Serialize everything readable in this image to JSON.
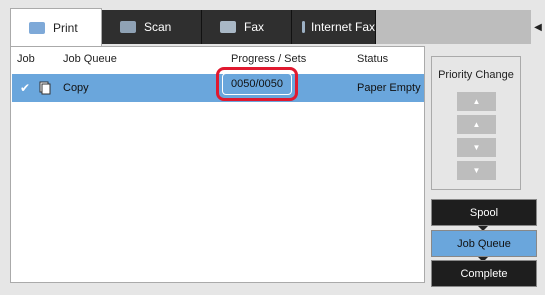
{
  "tabs": [
    {
      "label": "Print",
      "icon": "print-icon"
    },
    {
      "label": "Scan",
      "icon": "scan-icon"
    },
    {
      "label": "Fax",
      "icon": "fax-icon"
    },
    {
      "label": "Internet Fax",
      "icon": "internet-fax-icon"
    }
  ],
  "table": {
    "headers": {
      "job": "Job",
      "queue": "Job Queue",
      "progress": "Progress / Sets",
      "status": "Status"
    },
    "rows": [
      {
        "queue": "Copy",
        "progress": "0050/0050",
        "status": "Paper Empty"
      }
    ]
  },
  "priority": {
    "label": "Priority Change"
  },
  "modes": {
    "spool": "Spool",
    "job_queue": "Job Queue",
    "complete": "Complete"
  },
  "colors": {
    "accent": "#6aa6dc",
    "highlight": "#e0192f",
    "dark": "#1e1e1e"
  }
}
